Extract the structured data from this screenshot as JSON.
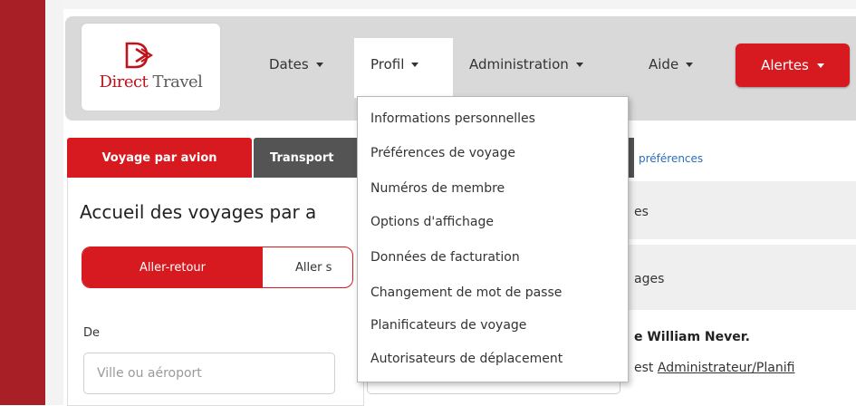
{
  "colors": {
    "brand_red": "#d71920",
    "dark_red": "#a82026",
    "tab_dark": "#545454",
    "link_blue": "#2a6ebb"
  },
  "logo": {
    "text_a": "Direct",
    "text_b": " Travel",
    "icon": "direct-travel-logo-icon"
  },
  "nav": {
    "dates": "Dates",
    "profil": "Profil",
    "administration": "Administration",
    "aide": "Aide",
    "alertes": "Alertes"
  },
  "profil_menu": [
    "Informations personnelles",
    "Préférences de voyage",
    "Numéros de membre",
    "Options d'affichage",
    "Données de facturation",
    "Changement de mot de passe",
    "Planificateurs de voyage",
    "Autorisateurs de déplacement"
  ],
  "tabs": {
    "air": "Voyage par avion",
    "transport": "Transport"
  },
  "preferences_link": "préférences",
  "booking": {
    "title": "Accueil des voyages par a",
    "trip_type_active": "Aller-retour",
    "trip_type_other": "Aller s",
    "from_label": "De",
    "from_placeholder": "Ville ou aéroport"
  },
  "right_panel": {
    "section_a": "es",
    "section_b": "ages",
    "welcome": "e William Never.",
    "role_prefix": "est ",
    "role_link": "Administrateur/Planifi"
  }
}
